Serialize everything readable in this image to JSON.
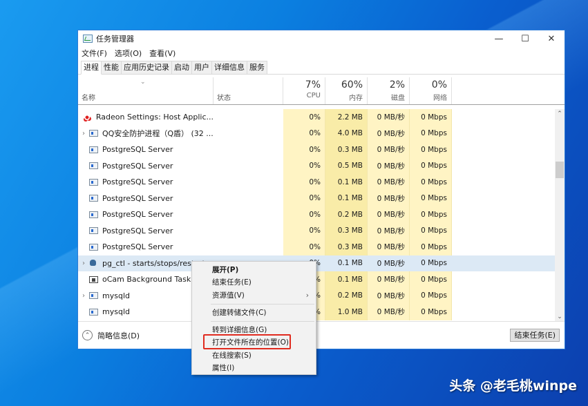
{
  "window": {
    "title": "任务管理器",
    "controls": {
      "minimize": "—",
      "maximize": "☐",
      "close": "✕"
    }
  },
  "menubar": [
    "文件(F)",
    "选项(O)",
    "查看(V)"
  ],
  "tabs": [
    {
      "label": "进程",
      "active": true
    },
    {
      "label": "性能",
      "active": false
    },
    {
      "label": "应用历史记录",
      "active": false
    },
    {
      "label": "启动",
      "active": false
    },
    {
      "label": "用户",
      "active": false
    },
    {
      "label": "详细信息",
      "active": false
    },
    {
      "label": "服务",
      "active": false
    }
  ],
  "header": {
    "sort_icon": "chevron-down",
    "name": "名称",
    "status": "状态",
    "cpu": {
      "pct": "7%",
      "label": "CPU"
    },
    "mem": {
      "pct": "60%",
      "label": "内存"
    },
    "disk": {
      "pct": "2%",
      "label": "磁盘"
    },
    "net": {
      "pct": "0%",
      "label": "网络"
    }
  },
  "rows": [
    {
      "name": "Radeon Settings: Host Applic...",
      "icon": "radeon-icon",
      "expandable": false,
      "cpu": "0%",
      "mem": "2.2 MB",
      "disk": "0 MB/秒",
      "net": "0 Mbps"
    },
    {
      "name": "QQ安全防护进程（Q盾） (32 ...",
      "icon": "app-window-icon",
      "expandable": true,
      "cpu": "0%",
      "mem": "4.0 MB",
      "disk": "0 MB/秒",
      "net": "0 Mbps"
    },
    {
      "name": "PostgreSQL Server",
      "icon": "app-window-icon",
      "expandable": false,
      "cpu": "0%",
      "mem": "0.3 MB",
      "disk": "0 MB/秒",
      "net": "0 Mbps"
    },
    {
      "name": "PostgreSQL Server",
      "icon": "app-window-icon",
      "expandable": false,
      "cpu": "0%",
      "mem": "0.5 MB",
      "disk": "0 MB/秒",
      "net": "0 Mbps"
    },
    {
      "name": "PostgreSQL Server",
      "icon": "app-window-icon",
      "expandable": false,
      "cpu": "0%",
      "mem": "0.1 MB",
      "disk": "0 MB/秒",
      "net": "0 Mbps"
    },
    {
      "name": "PostgreSQL Server",
      "icon": "app-window-icon",
      "expandable": false,
      "cpu": "0%",
      "mem": "0.1 MB",
      "disk": "0 MB/秒",
      "net": "0 Mbps"
    },
    {
      "name": "PostgreSQL Server",
      "icon": "app-window-icon",
      "expandable": false,
      "cpu": "0%",
      "mem": "0.2 MB",
      "disk": "0 MB/秒",
      "net": "0 Mbps"
    },
    {
      "name": "PostgreSQL Server",
      "icon": "app-window-icon",
      "expandable": false,
      "cpu": "0%",
      "mem": "0.3 MB",
      "disk": "0 MB/秒",
      "net": "0 Mbps"
    },
    {
      "name": "PostgreSQL Server",
      "icon": "app-window-icon",
      "expandable": false,
      "cpu": "0%",
      "mem": "0.3 MB",
      "disk": "0 MB/秒",
      "net": "0 Mbps"
    },
    {
      "name": "pg_ctl - starts/stops/restarts",
      "icon": "postgres-elephant-icon",
      "expandable": true,
      "selected": true,
      "cpu": "0%",
      "mem": "0.1 MB",
      "disk": "0 MB/秒",
      "net": "0 Mbps"
    },
    {
      "name": "oCam Background Task",
      "icon": "ocam-icon",
      "expandable": false,
      "cpu": "0%",
      "mem": "0.1 MB",
      "disk": "0 MB/秒",
      "net": "0 Mbps"
    },
    {
      "name": "mysqld",
      "icon": "app-window-icon",
      "expandable": true,
      "cpu": "0%",
      "mem": "0.2 MB",
      "disk": "0 MB/秒",
      "net": "0 Mbps"
    },
    {
      "name": "mysqld",
      "icon": "app-window-icon",
      "expandable": false,
      "cpu": "0%",
      "mem": "1.0 MB",
      "disk": "0 MB/秒",
      "net": "0 Mbps"
    }
  ],
  "footer": {
    "fewer_details": "简略信息(D)",
    "end_task": "结束任务(E)"
  },
  "context_menu": {
    "items": [
      {
        "label": "展开(P)",
        "bold": true
      },
      {
        "label": "结束任务(E)"
      },
      {
        "label": "资源值(V)",
        "submenu": true,
        "arrow": "›"
      },
      {
        "separator": true
      },
      {
        "label": "创建转储文件(C)"
      },
      {
        "separator": true
      },
      {
        "label": "转到详细信息(G)"
      },
      {
        "label": "打开文件所在的位置(O)",
        "highlighted": true
      },
      {
        "label": "在线搜索(S)"
      },
      {
        "label": "属性(I)"
      }
    ],
    "highlight_color": "#e02a1e"
  },
  "watermark": "头条 @老毛桃winpe",
  "colors": {
    "metric_bg": "#fff4c4",
    "mem_bg": "#f9eca8",
    "selected_row": "#dce9f5",
    "window_border": "#2a7ad6"
  }
}
